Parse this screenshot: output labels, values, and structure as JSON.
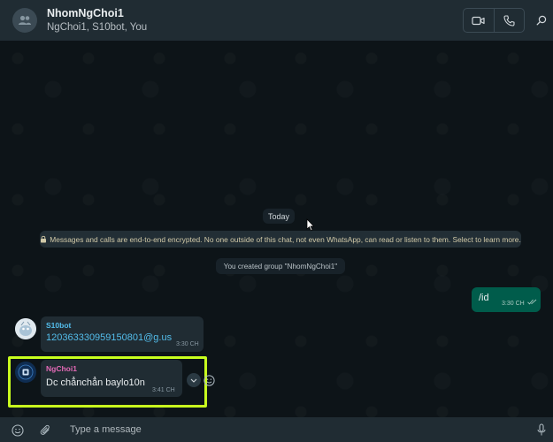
{
  "header": {
    "title": "NhomNgChoi1",
    "subtitle": "NgChoi1, S10bot, You",
    "icons": {
      "avatar": "group-avatar-icon",
      "video": "video-call-icon",
      "voice": "voice-call-icon",
      "search": "search-icon"
    }
  },
  "chat": {
    "date_divider": "Today",
    "encryption_notice": "Messages and calls are end-to-end encrypted. No one outside of this chat, not even WhatsApp, can read or listen to them. Select to learn more.",
    "system_message": "You created group \"NhomNgChoi1\"",
    "messages": [
      {
        "direction": "outgoing",
        "text": "/id",
        "time": "3:30 CH",
        "status": "read"
      },
      {
        "direction": "incoming",
        "sender": "S10bot",
        "text": "120363330959150801@g.us",
        "time": "3:30 CH"
      },
      {
        "direction": "incoming",
        "sender": "NgChoi1",
        "text": "Dc chẳnchẳn baylo10n",
        "time": "3:41 CH",
        "highlighted": true
      }
    ]
  },
  "composer": {
    "placeholder": "Type a message",
    "icons": {
      "emoji": "emoji-icon",
      "attach": "paperclip-icon",
      "mic": "microphone-icon"
    }
  },
  "colors": {
    "header_bg": "#202c33",
    "chat_bg": "#0d1418",
    "outgoing_bubble": "#005c4b",
    "incoming_bubble": "#202c33",
    "highlight": "#c8ff1e",
    "sender_s10bot": "#53bdeb",
    "sender_ngchoi1": "#e26ab6"
  }
}
